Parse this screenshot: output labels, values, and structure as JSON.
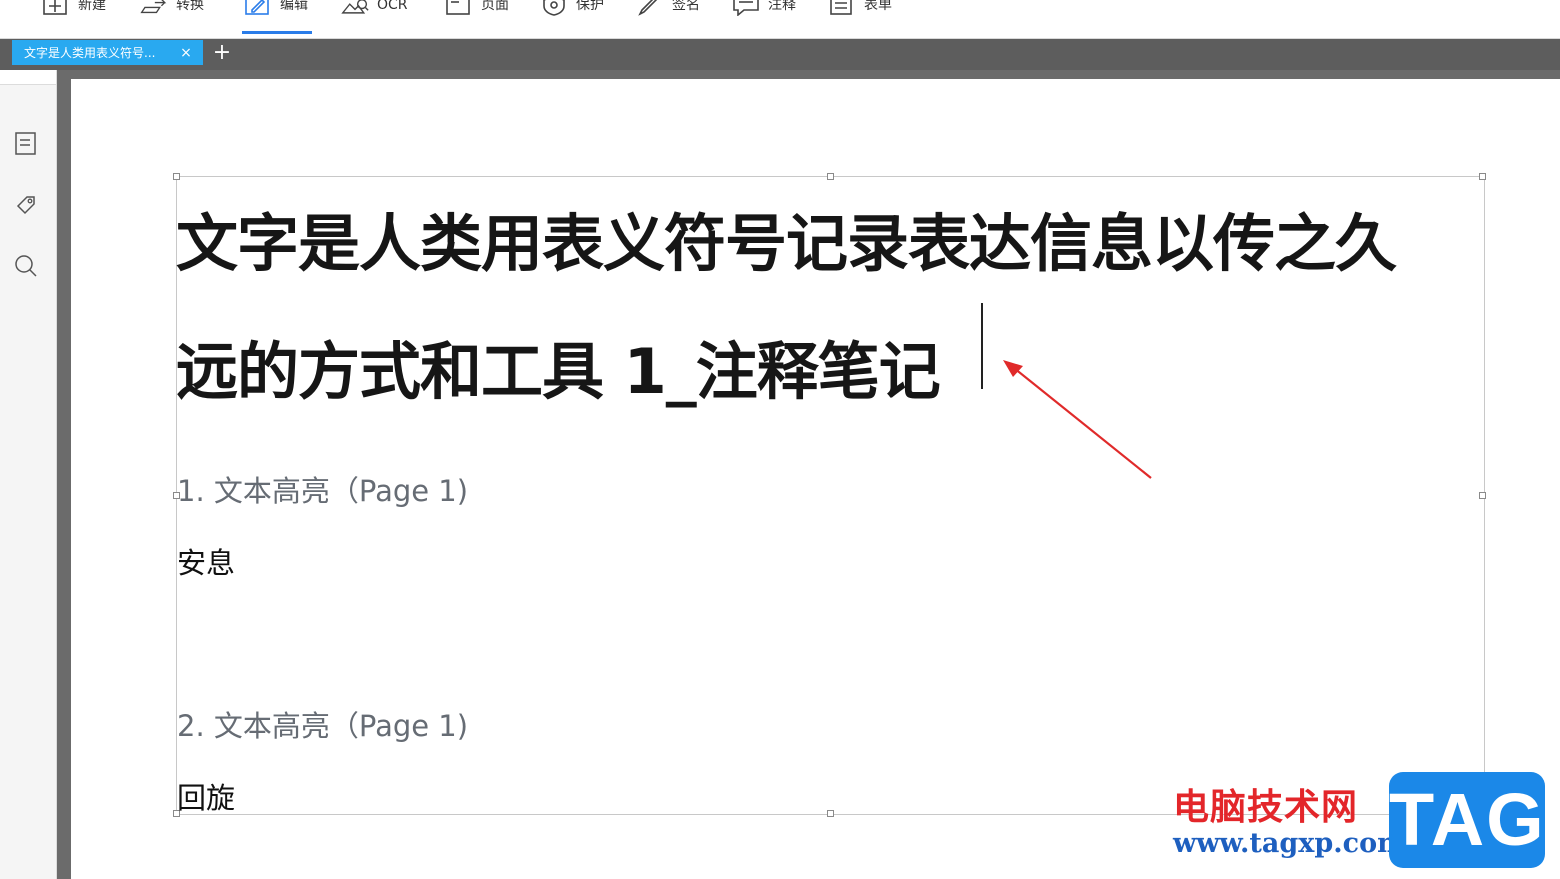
{
  "toolbar": {
    "items": [
      {
        "label": "新建",
        "icon": "new-file-icon"
      },
      {
        "label": "转换",
        "icon": "convert-icon"
      },
      {
        "label": "编辑",
        "icon": "edit-icon",
        "active": true
      },
      {
        "label": "OCR",
        "icon": "ocr-icon"
      },
      {
        "label": "页面",
        "icon": "page-icon"
      },
      {
        "label": "保护",
        "icon": "protect-icon"
      },
      {
        "label": "签名",
        "icon": "signature-icon"
      },
      {
        "label": "注释",
        "icon": "comment-icon"
      },
      {
        "label": "表单",
        "icon": "form-icon"
      }
    ],
    "accent_color": "#2b7de9"
  },
  "tabs": {
    "active_title": "文字是人类用表义符号...",
    "close_glyph": "×",
    "add_glyph": "+",
    "tab_color": "#29a9f0"
  },
  "left_panel": {
    "icons": [
      "thumbnail-icon",
      "tag-icon",
      "search-icon"
    ]
  },
  "document": {
    "title_line1": "文字是人类用表义符号记录表达信息以传之久",
    "title_line2": "远的方式和工具 1_注释笔记",
    "notes": [
      {
        "heading": "1. 文本高亮（Page 1)",
        "text": "安息"
      },
      {
        "heading": "2. 文本高亮（Page 1)",
        "text": "回旋"
      }
    ]
  },
  "watermark": {
    "site_name": "电脑技术网",
    "url": "www.tagxp.com",
    "tag": "TAG",
    "site_color": "#e3262a",
    "tag_color": "#1b88e8"
  }
}
